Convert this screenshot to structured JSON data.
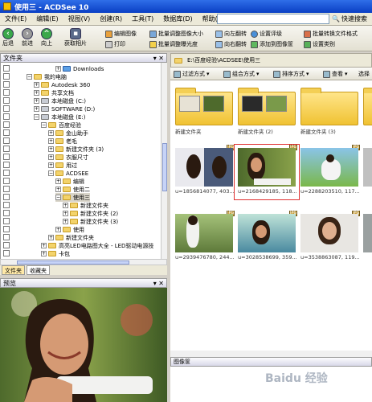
{
  "window": {
    "title": "使用三 - ACDSee 10"
  },
  "menu": {
    "items": [
      "文件(E)",
      "编辑(E)",
      "视图(V)",
      "创建(R)",
      "工具(T)",
      "数据库(D)",
      "帮助(H)"
    ],
    "quick_search": "快速搜索"
  },
  "toolbar": {
    "back": "后退",
    "forward": "前进",
    "up": "向上",
    "acquire": "获取相片",
    "edit_image": "编辑图像",
    "print": "打印",
    "batch_resize": "批量调整图像大小",
    "batch_exposure": "批量调整曝光度",
    "rotate_left": "向左翻转",
    "rotate_right": "向右翻转",
    "set_rating": "设置评级",
    "add_to_tray": "添加到图像筐",
    "batch_convert": "批量转换文件格式",
    "set_category": "设置类别"
  },
  "folders_panel": {
    "title": "文件夹",
    "items": [
      {
        "label": "Downloads",
        "level": 6
      },
      {
        "label": "我的电脑",
        "level": 2
      },
      {
        "label": "Autodesk 360",
        "level": 3
      },
      {
        "label": "共享文档",
        "level": 3
      },
      {
        "label": "本地磁盘 (C:)",
        "level": 3
      },
      {
        "label": "SOFTWARE (D:)",
        "level": 3
      },
      {
        "label": "本地磁盘 (E:)",
        "level": 3
      },
      {
        "label": "百度经验",
        "level": 4
      },
      {
        "label": "金山助手",
        "level": 5
      },
      {
        "label": "老毛",
        "level": 5
      },
      {
        "label": "新建文件夹 (3)",
        "level": 5
      },
      {
        "label": "衣服尺寸",
        "level": 5
      },
      {
        "label": "用过",
        "level": 5
      },
      {
        "label": "ACDSEE",
        "level": 5
      },
      {
        "label": "编辑",
        "level": 6
      },
      {
        "label": "使用二",
        "level": 6
      },
      {
        "label": "使用三",
        "level": 6
      },
      {
        "label": "新建文件夹",
        "level": 7
      },
      {
        "label": "新建文件夹 (2)",
        "level": 7
      },
      {
        "label": "新建文件夹 (3)",
        "level": 7
      },
      {
        "label": "使用",
        "level": 6
      },
      {
        "label": "新建文件夹",
        "level": 5
      },
      {
        "label": "高亮LED电路图大全 - LED驱动电源技",
        "level": 4
      },
      {
        "label": "卡包",
        "level": 4
      }
    ],
    "selected_index": 16,
    "tabs": [
      "文件夹",
      "收藏夹"
    ]
  },
  "preview_panel": {
    "title": "预览"
  },
  "path_bar": {
    "path": "E:\\百度经验\\ACDSEE\\使用三"
  },
  "view_bar": {
    "filter": "过滤方式",
    "group": "组合方式",
    "sort": "排序方式",
    "view": "查看",
    "select": "选择"
  },
  "grid": {
    "items": [
      {
        "caption": "新建文件夹",
        "kind": "folder"
      },
      {
        "caption": "新建文件夹 (2)",
        "kind": "folder"
      },
      {
        "caption": "新建文件夹 (3)",
        "kind": "folder"
      },
      {
        "caption": "u=1856814077, 403...",
        "kind": "photo"
      },
      {
        "caption": "u=2168429185, 118...",
        "kind": "photo"
      },
      {
        "caption": "u=2288203510, 117...",
        "kind": "photo"
      },
      {
        "caption": "u=2939476780, 244...",
        "kind": "photo"
      },
      {
        "caption": "u=3028538699, 359...",
        "kind": "photo"
      },
      {
        "caption": "u=3538863087, 119...",
        "kind": "photo"
      }
    ],
    "selected_index": 4
  },
  "properties_panel": {
    "title": "图像筐"
  },
  "watermark": "Baidu 经验"
}
